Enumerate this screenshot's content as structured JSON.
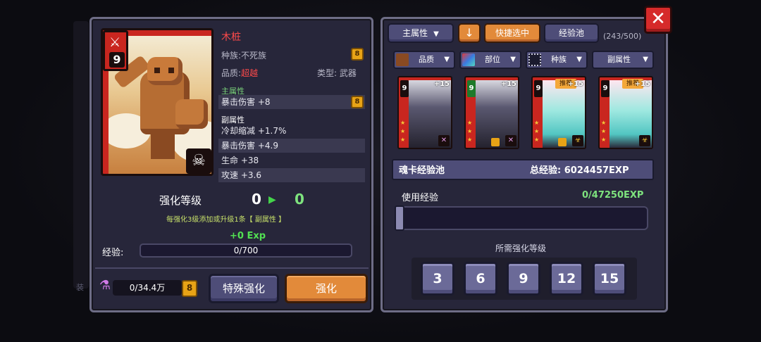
{
  "left": {
    "card_level": "9",
    "name": "木桩",
    "race": "种族:不死族",
    "quality_label": "品质:",
    "quality_value": "超越",
    "type": "类型:  武器",
    "main_stat_title": "主属性",
    "main_stat": "暴击伤害 +8",
    "sub_stat_title": "副属性",
    "sub_stats": [
      "冷却缩减 +1.7%",
      "暴击伤害 +4.9",
      "生命 +38",
      "攻速 +3.6"
    ],
    "enh_label": "强化等级",
    "enh_from": "0",
    "enh_to": "0",
    "enh_hint": "每强化3级添加或升级1条【 副属性 】",
    "exp_gain": "+0 Exp",
    "exp_label": "经验:",
    "exp_value": "0/700",
    "potion_value": "0/34.4万",
    "special_button": "特殊强化",
    "enhance_button": "强化",
    "side_text": "装"
  },
  "right": {
    "main_attr_button": "主属性",
    "quick_select_button": "快捷选中",
    "exp_pool_button": "经验池",
    "count": "(243/500)",
    "filters": [
      "品质",
      "部位",
      "种族",
      "副属性"
    ],
    "cards": [
      {
        "level": "9",
        "plus": "+15",
        "badge": ""
      },
      {
        "level": "9",
        "plus": "+15",
        "badge": ""
      },
      {
        "level": "9",
        "plus": "+15",
        "badge": "推荐"
      },
      {
        "level": "9",
        "plus": "+15",
        "badge": "推荐"
      }
    ],
    "pool_title": "魂卡经验池",
    "pool_total": "总经验:  6024457EXP",
    "use_label": "使用经验",
    "use_value": "0/47250EXP",
    "use_fraction": 0,
    "req_label": "所需强化等级",
    "levels": [
      "3",
      "6",
      "9",
      "12",
      "15"
    ]
  },
  "colors": {
    "accent_red": "#ff4a4a",
    "accent_green": "#7ee37e",
    "button_purple": "#4e4d78",
    "button_orange": "#e28a3a"
  },
  "icons": {
    "close": "close-icon",
    "arrow": "down-arrow-icon",
    "potion": "potion-icon",
    "skull": "skull-icon",
    "lock": "lock-icon"
  }
}
